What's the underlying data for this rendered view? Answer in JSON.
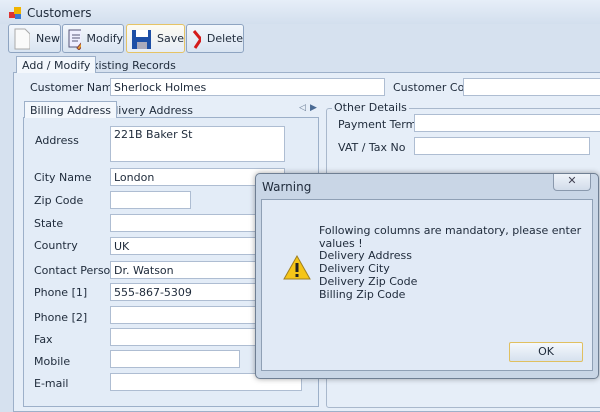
{
  "window": {
    "title": "Customers"
  },
  "toolbar": {
    "new": "New",
    "modify": "Modify",
    "save": "Save",
    "delete": "Delete"
  },
  "tabs": [
    {
      "label": "Add / Modify",
      "active": true
    },
    {
      "label": "Existing Records",
      "active": false
    }
  ],
  "header": {
    "customer_name_label": "Customer Name",
    "customer_name": "Sherlock Holmes",
    "customer_code_label": "Customer Code",
    "customer_code": ""
  },
  "address_tabs": [
    {
      "label": "Billing Address",
      "active": true
    },
    {
      "label": "Delivery Address",
      "active": false
    }
  ],
  "billing": {
    "address_label": "Address",
    "address": "221B Baker St",
    "city_label": "City Name",
    "city": "London",
    "zip_label": "Zip Code",
    "zip": "",
    "state_label": "State",
    "state": "",
    "country_label": "Country",
    "country": "UK",
    "contact_label": "Contact Person",
    "contact": "Dr. Watson",
    "phone1_label": "Phone [1]",
    "phone1": "555-867-5309",
    "phone2_label": "Phone [2]",
    "phone2": "",
    "fax_label": "Fax",
    "fax": "",
    "mobile_label": "Mobile",
    "mobile": "",
    "email_label": "E-mail",
    "email": ""
  },
  "other": {
    "group_label": "Other Details",
    "payment_terms_label": "Payment Terms",
    "payment_terms": "",
    "vat_label": "VAT / Tax No",
    "vat": ""
  },
  "dialog": {
    "title": "Warning",
    "message": "Following columns are mandatory, please enter values !",
    "items": [
      "Delivery Address",
      "Delivery City",
      "Delivery Zip Code",
      "Billing Zip Code"
    ],
    "ok": "OK",
    "icon": "warning-icon"
  }
}
